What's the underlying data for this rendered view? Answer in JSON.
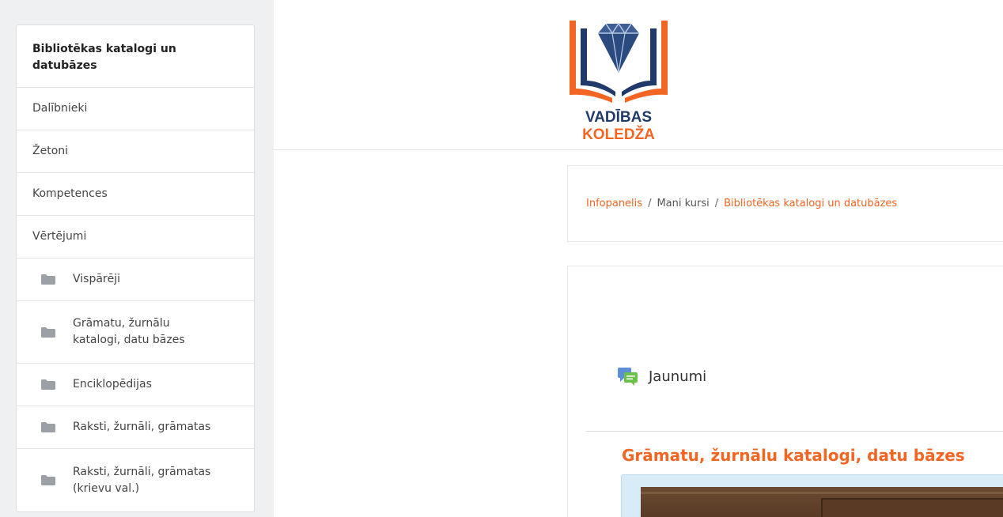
{
  "course_nav": {
    "title": "Bibliotēkas katalogi un datubāzes",
    "items": [
      {
        "label": "Dalībnieki"
      },
      {
        "label": "Žetoni"
      },
      {
        "label": "Kompetences"
      },
      {
        "label": "Vērtējumi"
      }
    ],
    "sections": [
      {
        "label": "Vispārēji"
      },
      {
        "label": "Grāmatu, žurnālu katalogi, datu bāzes"
      },
      {
        "label": "Enciklopēdijas"
      },
      {
        "label": "Raksti, žurnāli, grāmatas"
      },
      {
        "label": "Raksti, žurnāli, grāmatas (krievu val.)"
      }
    ]
  },
  "logo": {
    "line1": "VADĪBAS",
    "line2": "KOLEDŽA"
  },
  "breadcrumb": {
    "home": "Infopanelis",
    "separator": "/",
    "my_courses": "Mani kursi",
    "current": "Bibliotēkas katalogi un datubāzes"
  },
  "content": {
    "news_label": "Jaunumi",
    "section_title": "Grāmatu, žurnālu katalogi, datu bāzes"
  },
  "colors": {
    "accent": "#f26522",
    "navy": "#1f3a6b",
    "panel_bg": "#d8ecf7"
  }
}
